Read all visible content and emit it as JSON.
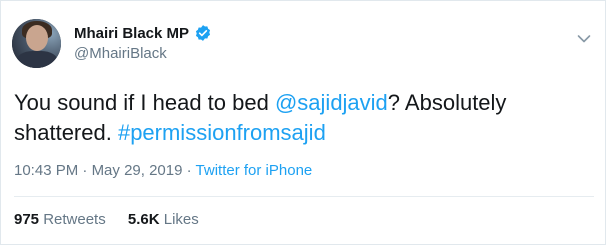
{
  "author": {
    "name": "Mhairi Black MP",
    "handle": "@MhairiBlack",
    "verified": true,
    "verified_icon": "verified-badge-icon",
    "verified_color": "#1da1f2"
  },
  "menu_icon": "chevron-down-icon",
  "tweet": {
    "text_1": "You sound if I head to bed ",
    "mention": "@sajidjavid",
    "text_2": "? Absolutely shattered.  ",
    "hashtag": "#permissionfromsajid"
  },
  "meta": {
    "time": "10:43 PM",
    "separator": " · ",
    "date": "May 29, 2019",
    "separator_2": " · ",
    "source": "Twitter for iPhone"
  },
  "stats": {
    "retweets_count": "975",
    "retweets_label": " Retweets",
    "likes_count": "5.6K",
    "likes_label": " Likes"
  },
  "colors": {
    "link": "#1da1f2",
    "secondary_text": "#657786",
    "primary_text": "#14171a",
    "border": "#e1e8ed"
  }
}
